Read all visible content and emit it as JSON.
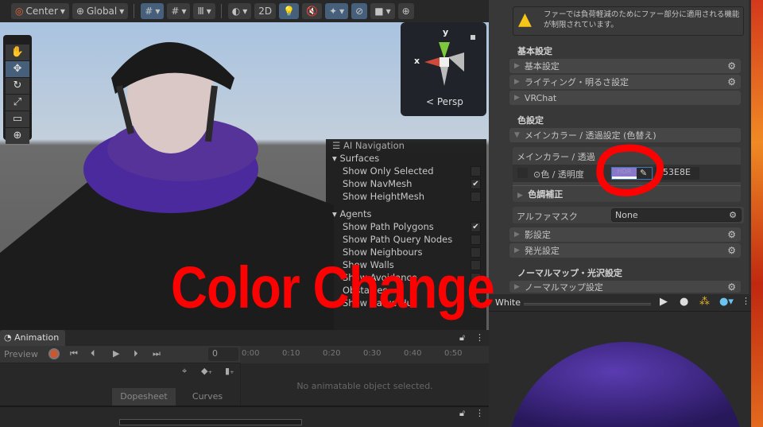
{
  "toolbar": {
    "pivot": "Center",
    "space": "Global",
    "mode_2d": "2D"
  },
  "scene": {
    "gizmo": {
      "y": "y",
      "x": "x",
      "projection": "Persp"
    }
  },
  "ai_navigation": {
    "title": "AI Navigation",
    "sections": [
      {
        "label": "Surfaces",
        "items": [
          {
            "label": "Show Only Selected",
            "checked": false
          },
          {
            "label": "Show NavMesh",
            "checked": true
          },
          {
            "label": "Show HeightMesh",
            "checked": false
          }
        ]
      },
      {
        "label": "Agents",
        "items": [
          {
            "label": "Show Path Polygons",
            "checked": true
          },
          {
            "label": "Show Path Query Nodes",
            "checked": false
          },
          {
            "label": "Show Neighbours",
            "checked": false
          },
          {
            "label": "Show Walls",
            "checked": false
          },
          {
            "label": "Show Avoidance",
            "checked": false
          }
        ]
      },
      {
        "label": "Obstacles",
        "items": [
          {
            "label": "Show Carve Hull",
            "checked": false
          }
        ]
      }
    ]
  },
  "overlay_text": "Color Change",
  "inspector": {
    "warning": "ファーでは負荷軽減のためにファー部分に適用される機能が制限されています。",
    "basic_header": "基本設定",
    "basic_folds": [
      "基本設定",
      "ライティング・明るさ設定",
      "VRChat"
    ],
    "color_header": "色設定",
    "main_color_fold": "メインカラー / 透過設定 (色替え)",
    "main_color_box": "メインカラー / 透過",
    "color_label": "⊙色 / 透明度",
    "hdr": "HDR",
    "hex": "553E8E",
    "swatch_color": "#8b77c9",
    "tone": "色調補正",
    "alpha_mask_label": "アルファマスク",
    "alpha_mask_value": "None",
    "shadow": "影設定",
    "emission": "発光設定",
    "normal_header": "ノーマルマップ・光沢設定",
    "normal_fold": "ノーマルマップ設定"
  },
  "preview": {
    "name": "White",
    "sphere_color": "#4a2f9a"
  },
  "animation": {
    "tab": "Animation",
    "preview": "Preview",
    "frame": "0",
    "ticks": [
      "0:00",
      "0:10",
      "0:20",
      "0:30",
      "0:40",
      "0:50"
    ],
    "empty": "No animatable object selected.",
    "dopesheet": "Dopesheet",
    "curves": "Curves"
  }
}
